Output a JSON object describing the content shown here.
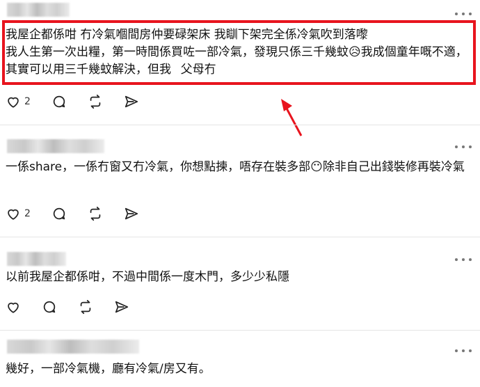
{
  "posts": [
    {
      "text": "我屋企都係咁 冇冷氣嗰間房仲要碌架床 我瞓下架完全係冷氣吹到落嚟\n我人生第一次出糧，第一時間係買咗一部冷氣，發現只係三千幾蚊😥我成個童年嘅不適，其實可以用三千幾蚊解決，但我父母冇",
      "likes": "2",
      "highlighted": true
    },
    {
      "text": "一係share，一係冇窗又冇冷氣，你想點揀，唔存在裝多部😶除非自己出錢裝修再裝冷氣",
      "likes": "2"
    },
    {
      "text": "以前我屋企都係咁，不過中間係一度木門，多少少私隱",
      "likes": ""
    },
    {
      "text": "幾好，一部冷氣機，廳有冷氣/房又有。",
      "likes": ""
    }
  ],
  "annotation": {
    "box_color": "#e8141e",
    "arrow_color": "#e8141e"
  },
  "icons": [
    "heart-icon",
    "comment-icon",
    "repost-icon",
    "share-icon",
    "more-icon"
  ]
}
